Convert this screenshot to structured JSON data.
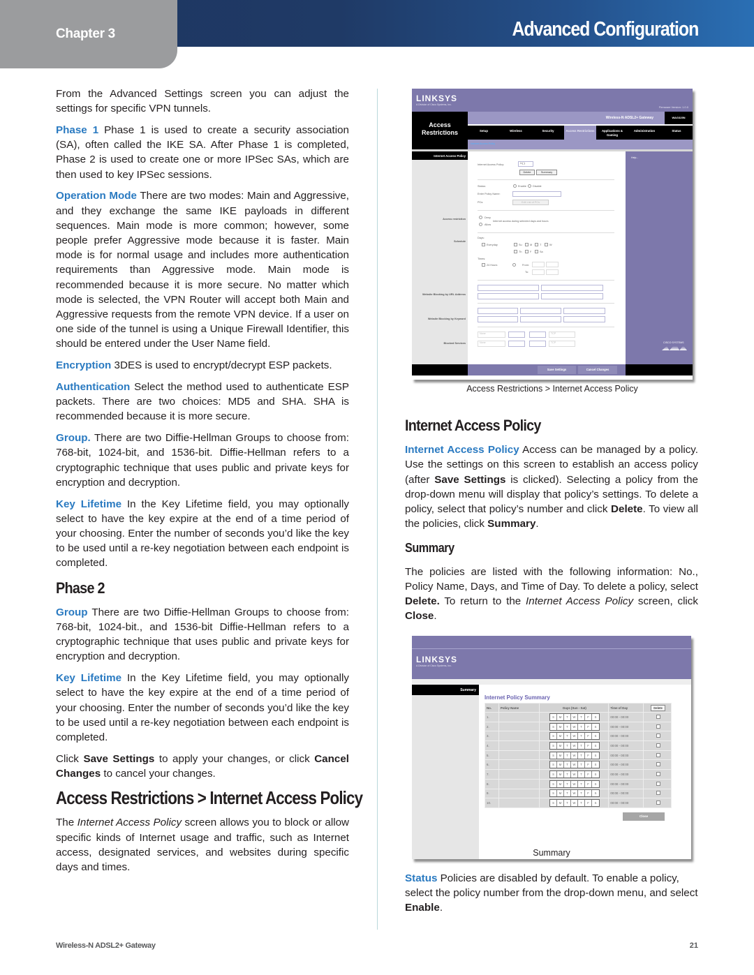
{
  "header": {
    "chapter": "Chapter 3",
    "title": "Advanced Configuration",
    "colors": {
      "bar_dark": "#1e3560",
      "bar_light": "#2a6fb4",
      "chapter_tab": "#9b9c9e",
      "term_blue": "#2a7ac1"
    }
  },
  "left_column": {
    "intro": "From the Advanced Settings screen you can adjust the settings for specific VPN tunnels.",
    "phase1": {
      "term": "Phase 1",
      "text": " Phase 1 is used to create a security association (SA), often called the IKE SA. After Phase 1 is completed, Phase 2 is used to create one or more IPSec SAs, which are then used to key IPSec sessions."
    },
    "operation_mode": {
      "term": "Operation Mode",
      "text": " There are two modes: Main and Aggressive, and they exchange the same IKE payloads in different sequences. Main mode is more common; however, some people prefer Aggressive mode because it is faster. Main mode is for normal usage and includes more authentication requirements than Aggressive mode. Main mode is recommended because it is more secure. No matter which mode is selected, the VPN Router will accept both Main and Aggressive requests from the remote VPN device. If a user on one side of the tunnel is using a Unique Firewall Identifier, this should be entered under the User Name field."
    },
    "encryption": {
      "term": "Encryption",
      "text": " 3DES is used to encrypt/decrypt ESP packets."
    },
    "authentication": {
      "term": "Authentication",
      "text": " Select the method used to authenticate ESP packets. There are two choices: MD5 and SHA. SHA is recommended because it is more secure."
    },
    "group1": {
      "term": "Group.",
      "text": " There are two Diffie-Hellman Groups to choose from: 768-bit, 1024-bit, and 1536-bit. Diffie-Hellman refers to a cryptographic technique that uses public and private keys for encryption and decryption."
    },
    "key_lifetime1": {
      "term": "Key Lifetime",
      "text": " In the Key Lifetime field, you may optionally select to have the key expire at the end of a time period of your choosing. Enter the number of seconds you’d like the key to be used until a re-key negotiation between each endpoint is completed."
    },
    "phase2_heading": "Phase 2",
    "group2": {
      "term": "Group",
      "text": " There are two Diffie-Hellman Groups to choose from: 768-bit, 1024-bit., and 1536-bit Diffie-Hellman refers to a cryptographic technique that uses public and private keys for encryption and decryption."
    },
    "key_lifetime2": {
      "term": "Key Lifetime",
      "text": " In the Key Lifetime field, you may optionally select to have the key expire at the end of a time period of your choosing. Enter the number of seconds you’d like the key to be used until a re-key negotiation between each endpoint is completed."
    },
    "save_note": {
      "pre": "Click ",
      "save": "Save Settings",
      "mid": " to apply your changes, or click ",
      "cancel": "Cancel Changes",
      "post": " to cancel your changes."
    },
    "access_heading": "Access Restrictions > Internet Access Policy",
    "access_intro": {
      "pre": "The ",
      "ital": "Internet Access Policy",
      "post": " screen allows you to block or allow specific kinds of Internet usage and traffic, such as Internet access, designated services, and websites during specific days and times."
    }
  },
  "screenshot1": {
    "logo": "LINKSYS",
    "logo_sub": "A Division of Cisco Systems, Inc.",
    "firmware": "Firmware Version: 1.0.0",
    "section": "Access Restrictions",
    "product": "Wireless-N ADSL2+ Gateway",
    "model": "WAG325N",
    "tabs": [
      "Setup",
      "Wireless",
      "Security",
      "Access Restrictions",
      "Applications & Gaming",
      "Administration",
      "Status"
    ],
    "active_tab": "Access Restrictions",
    "subnav": "Internet Access Policy",
    "left_header": "Internet Access Policy",
    "left_labels": [
      "Access restriction",
      "Schedule",
      "Website Blocking by URL Address",
      "Website Blocking by Keyword",
      "Blocked Services"
    ],
    "help": "Help...",
    "form": {
      "policy_label": "Internet Access Policy:",
      "policy_value": "1 ( )",
      "delete": "Delete",
      "summary": "Summary",
      "status_label": "Status:",
      "enable": "Enable",
      "disable": "Disable",
      "policy_name_label": "Enter Policy Name:",
      "pcs_label": "PCs:",
      "edit_pcs": "Edit List of PCs",
      "deny": "Deny",
      "allow": "Allow",
      "access_text": "Internet access during selected days and hours",
      "days_label": "Days:",
      "everyday": "Everyday",
      "days": [
        "Su",
        "M",
        "T",
        "W",
        "Th",
        "F",
        "Sa"
      ],
      "times_label": "Times:",
      "hours24": "24 Hours",
      "from": "From:",
      "to": "To:",
      "time_value": "00",
      "service_value": "None",
      "proto_value": "TCP"
    },
    "save": "Save Settings",
    "cancel": "Cancel Changes",
    "cisco": "CISCO SYSTEMS"
  },
  "caption1": "Access Restrictions > Internet Access Policy",
  "right_column": {
    "iap_heading": "Internet Access Policy",
    "iap": {
      "term": "Internet Access Policy",
      "t1": " Access can be managed by a policy. Use the settings on this screen to establish an access policy (after ",
      "b1": "Save Settings",
      "t2": " is clicked). Selecting a policy from the drop-down menu will display that policy’s settings. To delete a policy, select that policy’s number and click ",
      "b2": "Delete",
      "t3": ". To view all the policies, click ",
      "b3": "Summary",
      "t4": "."
    },
    "summary_heading": "Summary",
    "summary": {
      "t1": "The policies are listed with the following information: No., Policy Name, Days, and Time of Day. To delete a policy, select ",
      "b1": "Delete.",
      "t2": " To return to the ",
      "i1": "Internet Access Policy",
      "t3": " screen, click ",
      "b2": "Close",
      "t4": "."
    },
    "status": {
      "term": "Status",
      "t1": "  Policies are disabled by default. To enable a policy, select the policy number from the drop-down menu, and select ",
      "b1": "Enable",
      "t2": "."
    }
  },
  "screenshot2": {
    "logo": "LINKSYS",
    "logo_sub": "A Division of Cisco Systems, Inc.",
    "left_header": "Summary",
    "title": "Internet Policy Summary",
    "columns": [
      "No.",
      "Policy Name",
      "Days (Sun - Sat)",
      "Time of Day",
      "Delete"
    ],
    "day_letters": [
      "S",
      "M",
      "T",
      "W",
      "T",
      "F",
      "S"
    ],
    "rows": [
      {
        "no": "1.",
        "name": "",
        "time": "00:00 - 00:00",
        "delete": false
      },
      {
        "no": "2.",
        "name": "",
        "time": "00:00 - 00:00",
        "delete": false
      },
      {
        "no": "3.",
        "name": "",
        "time": "00:00 - 00:00",
        "delete": false
      },
      {
        "no": "4.",
        "name": "",
        "time": "00:00 - 00:00",
        "delete": false
      },
      {
        "no": "5.",
        "name": "",
        "time": "00:00 - 00:00",
        "delete": false
      },
      {
        "no": "6.",
        "name": "",
        "time": "00:00 - 00:00",
        "delete": false
      },
      {
        "no": "7.",
        "name": "",
        "time": "00:00 - 00:00",
        "delete": false
      },
      {
        "no": "8.",
        "name": "",
        "time": "00:00 - 00:00",
        "delete": false
      },
      {
        "no": "9.",
        "name": "",
        "time": "00:00 - 00:00",
        "delete": false
      },
      {
        "no": "10.",
        "name": "",
        "time": "00:00 - 00:00",
        "delete": false
      }
    ],
    "close": "Close"
  },
  "caption2": "Summary",
  "footer": {
    "product": "Wireless-N ADSL2+ Gateway",
    "page": "21"
  }
}
